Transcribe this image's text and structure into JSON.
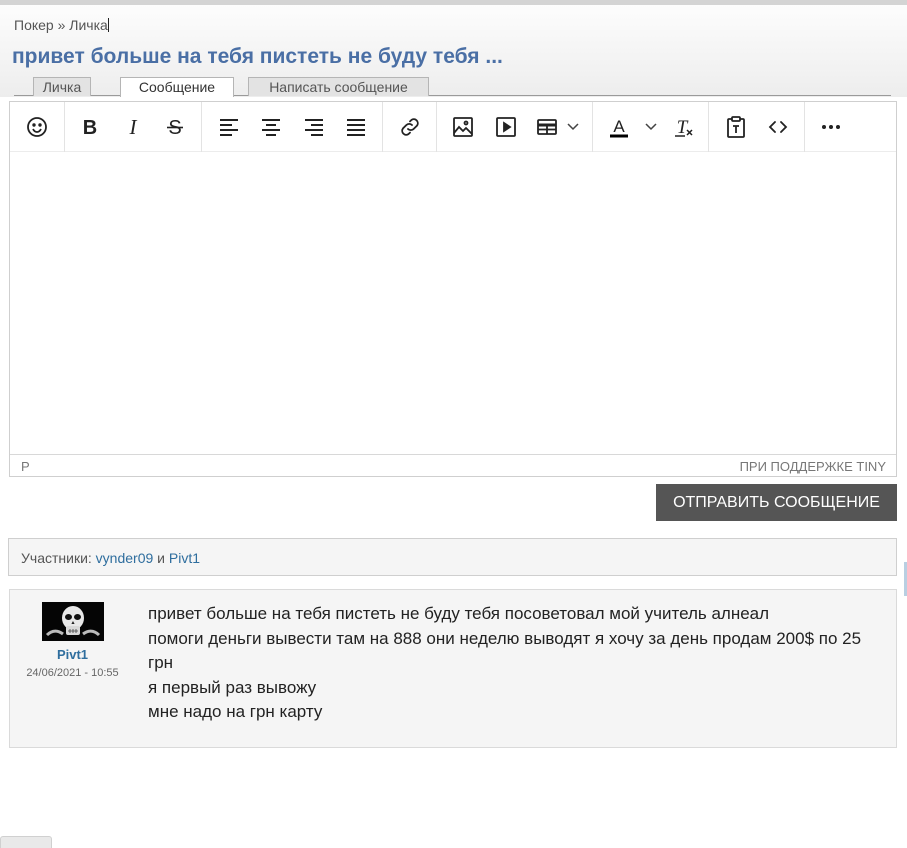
{
  "breadcrumb": {
    "root": "Покер",
    "separator": "»",
    "current": "Личка"
  },
  "page_title": "привет больше на тебя пистеть не буду тебя ...",
  "tabs": [
    {
      "label": "Личка",
      "active": false
    },
    {
      "label": "Сообщение",
      "active": true
    },
    {
      "label": "Написать сообщение",
      "active": false
    }
  ],
  "toolbar": {
    "icons": [
      "emoji-icon",
      "bold-icon",
      "italic-icon",
      "strikethrough-icon",
      "align-left-icon",
      "align-center-icon",
      "align-right-icon",
      "align-justify-icon",
      "link-icon",
      "image-icon",
      "media-icon",
      "table-icon",
      "text-color-icon",
      "clear-formatting-icon",
      "paste-text-icon",
      "code-icon",
      "more-icon"
    ]
  },
  "editor": {
    "status_path": "P",
    "powered_by": "При поддержке Tiny"
  },
  "send_button": "ОТПРАВИТЬ СООБЩЕНИЕ",
  "participants": {
    "label": "Участники:",
    "user1": "vynder09",
    "conjunction": "и",
    "user2": "Pivt1"
  },
  "message": {
    "author": "Pivt1",
    "date": "24/06/2021 - 10:55",
    "lines": [
      "привет больше на тебя пистеть не буду тебя посоветовал мой учитель алнеал",
      "помоги деньги вывести там на 888 они неделю выводят я хочу за день продам 200$ по 25 грн",
      "я первый раз вывожу",
      "мне надо на грн карту"
    ]
  },
  "colors": {
    "title": "#4a6fa5",
    "link": "#2f6e9e",
    "button": "#555555"
  }
}
